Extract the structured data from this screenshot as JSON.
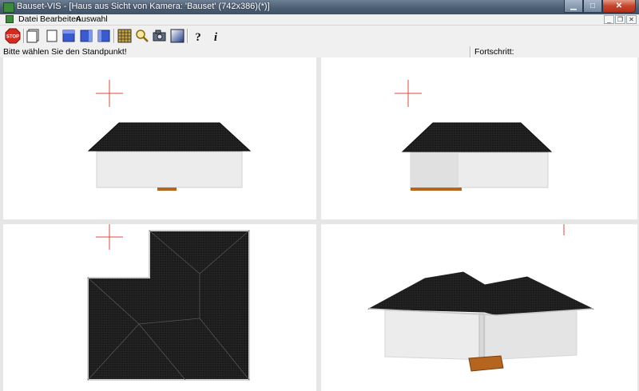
{
  "window": {
    "title": "Bauset-VIS - [Haus aus Sicht von Kamera: 'Bauset' (742x386)(*)]"
  },
  "menu": {
    "items": [
      "Datei",
      "Bearbeiten",
      "Auswahl"
    ]
  },
  "toolbar": {
    "buttons": [
      {
        "name": "stop-button",
        "icon": "stop-icon",
        "label": "STOP"
      },
      {
        "name": "view-front-button",
        "icon": "window-outline-icon"
      },
      {
        "name": "view-back-button",
        "icon": "window-outline-icon"
      },
      {
        "name": "view-blue-1-button",
        "icon": "blue-box-icon"
      },
      {
        "name": "view-blue-2-button",
        "icon": "blue-box-icon"
      },
      {
        "name": "view-blue-3-button",
        "icon": "blue-box-icon"
      },
      {
        "name": "material-button",
        "icon": "grid-texture-icon"
      },
      {
        "name": "zoom-button",
        "icon": "magnifier-icon"
      },
      {
        "name": "camera-button",
        "icon": "camera-icon"
      },
      {
        "name": "render-button",
        "icon": "gradient-square-icon"
      },
      {
        "name": "help-button",
        "icon": "question-icon",
        "label": "?"
      },
      {
        "name": "info-button",
        "icon": "info-icon",
        "label": "i"
      }
    ]
  },
  "status": {
    "message": "Bitte wählen Sie den Standpunkt!",
    "progress_label": "Fortschritt:"
  },
  "colors": {
    "roof": "#1a1a1a",
    "wall": "#ececec",
    "crosshair": "#e0483c",
    "wood": "#b5651d",
    "accent_blue": "#3a5bd0"
  }
}
